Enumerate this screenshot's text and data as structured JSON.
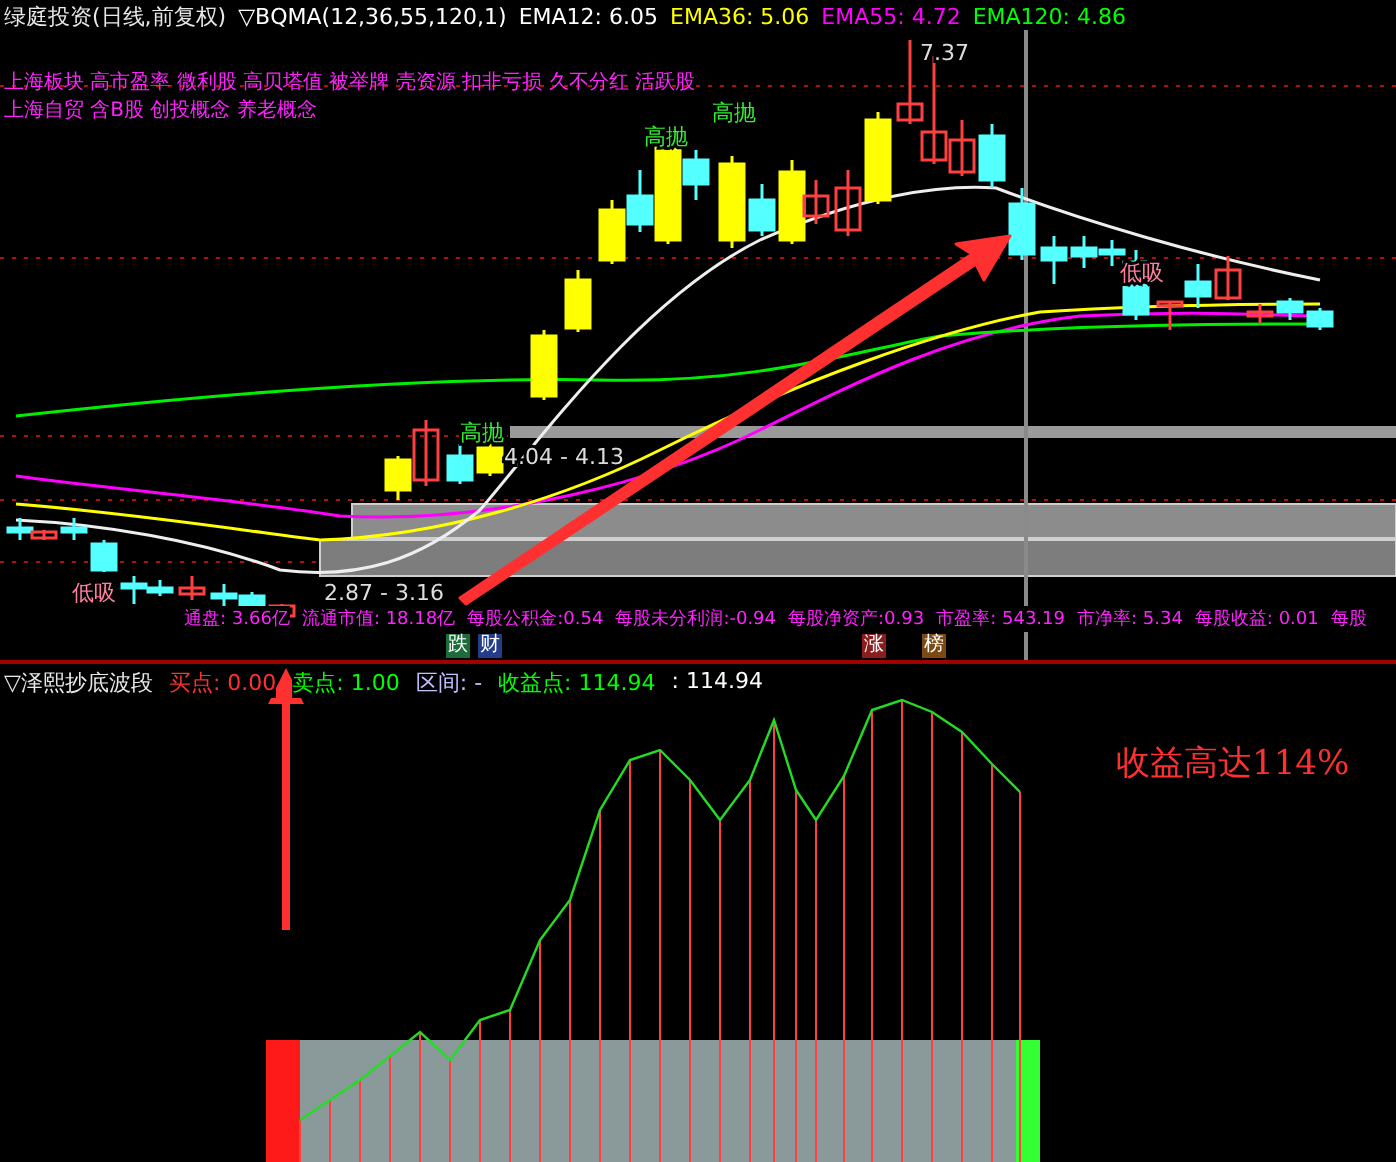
{
  "header": {
    "title": "绿庭投资(日线,前复权)",
    "indicators": [
      {
        "text": "▽BQMA(12,36,55,120,1)",
        "color": "#ffffff"
      },
      {
        "text": "EMA12: 6.05",
        "color": "#ffffff"
      },
      {
        "text": "EMA36: 5.06",
        "color": "#ffff00"
      },
      {
        "text": "EMA55: 4.72",
        "color": "#ff00ff"
      },
      {
        "text": "EMA120: 4.86",
        "color": "#00ff00"
      }
    ]
  },
  "concepts": [
    "上海板块 高市盈率 微利股 高贝塔值 被举牌 壳资源 扣非亏损 久不分红 活跃股",
    "上海自贸 含B股 创投概念 养老概念"
  ],
  "chart_labels": [
    {
      "kind": "sell",
      "text": "高抛"
    },
    {
      "kind": "sell",
      "text": "高抛"
    },
    {
      "kind": "sell",
      "text": "高抛"
    },
    {
      "kind": "buy",
      "text": "低吸"
    },
    {
      "kind": "buy",
      "text": "低吸"
    },
    {
      "kind": "price",
      "text": "7.37"
    },
    {
      "kind": "price",
      "text": "4.04 - 4.13"
    },
    {
      "kind": "price",
      "text": "2.87 - 3.16"
    }
  ],
  "stats": [
    "通盘: 3.66亿",
    "流通市值: 18.18亿",
    "每股公积金:0.54",
    "每股未分利润:-0.94",
    "每股净资产:0.93",
    "市盈率: 543.19",
    "市净率: 5.34",
    "每股收益: 0.01",
    "每股"
  ],
  "badges": [
    {
      "text": "跌",
      "color": "#1e6b3a"
    },
    {
      "text": "财",
      "color": "#233d8a"
    },
    {
      "text": "涨",
      "color": "#8a1e1e"
    },
    {
      "text": "榜",
      "color": "#7a4a14"
    }
  ],
  "sub_panel": {
    "title": "▽泽熙抄底波段",
    "items": [
      {
        "text": "买点: 0.00",
        "color": "#ff3030"
      },
      {
        "text": "卖点: 1.00",
        "color": "#00ff00"
      },
      {
        "text": "区间: -",
        "color": "#c0c0ff"
      },
      {
        "text": "收益点: 114.94",
        "color": "#00ff00"
      },
      {
        "text": ": 114.94",
        "color": "#ffffff"
      }
    ],
    "note": "收益高达114%"
  }
}
